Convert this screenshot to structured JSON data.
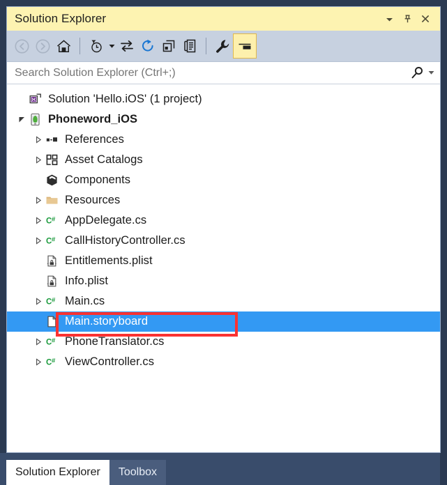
{
  "window": {
    "title": "Solution Explorer",
    "controls": [
      {
        "name": "dropdown-icon",
        "label": "▼"
      },
      {
        "name": "pin-icon",
        "label": "pin"
      },
      {
        "name": "close-icon",
        "label": "✕"
      }
    ]
  },
  "toolbar": {
    "buttons": [
      {
        "name": "back-button",
        "icon": "back-icon",
        "state": "disabled",
        "tooltip": "Back"
      },
      {
        "name": "forward-button",
        "icon": "forward-icon",
        "state": "disabled",
        "tooltip": "Forward"
      },
      {
        "name": "home-button",
        "icon": "home-icon",
        "state": "enabled",
        "tooltip": "Home"
      },
      {
        "name": "pending-changes-button",
        "icon": "clock-filter-icon",
        "state": "enabled",
        "tooltip": "Pending Changes Filter"
      },
      {
        "name": "sync-button",
        "icon": "sync-arrows-icon",
        "state": "enabled",
        "tooltip": "Sync with Active Document"
      },
      {
        "name": "refresh-button",
        "icon": "refresh-icon",
        "state": "enabled",
        "tooltip": "Refresh"
      },
      {
        "name": "collapse-all-button",
        "icon": "collapse-all-icon",
        "state": "enabled",
        "tooltip": "Collapse All"
      },
      {
        "name": "show-all-files-button",
        "icon": "show-all-files-icon",
        "state": "enabled",
        "tooltip": "Show All Files"
      },
      {
        "name": "properties-button",
        "icon": "wrench-icon",
        "state": "enabled",
        "tooltip": "Properties"
      },
      {
        "name": "preview-button",
        "icon": "preview-pane-icon",
        "state": "active",
        "tooltip": "Preview Selected Items"
      }
    ]
  },
  "search": {
    "placeholder": "Search Solution Explorer (Ctrl+;)",
    "value": ""
  },
  "tree": {
    "items": [
      {
        "label": "Solution 'Hello.iOS' (1 project)",
        "icon": "solution-icon",
        "indent": 0,
        "expander": "none",
        "bold": false,
        "selected": false
      },
      {
        "label": "Phoneword_iOS",
        "icon": "ios-project-icon",
        "indent": 0,
        "expander": "expanded",
        "bold": true,
        "selected": false
      },
      {
        "label": "References",
        "icon": "references-icon",
        "indent": 1,
        "expander": "collapsed",
        "bold": false,
        "selected": false
      },
      {
        "label": "Asset Catalogs",
        "icon": "asset-catalog-icon",
        "indent": 1,
        "expander": "collapsed",
        "bold": false,
        "selected": false
      },
      {
        "label": "Components",
        "icon": "components-icon",
        "indent": 1,
        "expander": "none",
        "bold": false,
        "selected": false
      },
      {
        "label": "Resources",
        "icon": "folder-icon",
        "indent": 1,
        "expander": "collapsed",
        "bold": false,
        "selected": false
      },
      {
        "label": "AppDelegate.cs",
        "icon": "csharp-file-icon",
        "indent": 1,
        "expander": "collapsed",
        "bold": false,
        "selected": false
      },
      {
        "label": "CallHistoryController.cs",
        "icon": "csharp-file-icon",
        "indent": 1,
        "expander": "collapsed",
        "bold": false,
        "selected": false
      },
      {
        "label": "Entitlements.plist",
        "icon": "plist-file-icon",
        "indent": 1,
        "expander": "none",
        "bold": false,
        "selected": false
      },
      {
        "label": "Info.plist",
        "icon": "plist-file-icon",
        "indent": 1,
        "expander": "none",
        "bold": false,
        "selected": false
      },
      {
        "label": "Main.cs",
        "icon": "csharp-file-icon",
        "indent": 1,
        "expander": "collapsed",
        "bold": false,
        "selected": false
      },
      {
        "label": "Main.storyboard",
        "icon": "document-icon",
        "indent": 1,
        "expander": "none",
        "bold": false,
        "selected": true
      },
      {
        "label": "PhoneTranslator.cs",
        "icon": "csharp-file-icon",
        "indent": 1,
        "expander": "collapsed",
        "bold": false,
        "selected": false
      },
      {
        "label": "ViewController.cs",
        "icon": "csharp-file-icon",
        "indent": 1,
        "expander": "collapsed",
        "bold": false,
        "selected": false
      }
    ]
  },
  "annotation": {
    "name": "highlight-box",
    "target": "CallHistoryController.cs",
    "color": "#fa3232"
  },
  "tabs": [
    {
      "label": "Solution Explorer",
      "active": true
    },
    {
      "label": "Toolbox",
      "active": false
    }
  ],
  "colors": {
    "titlebar_bg": "#fdf3b1",
    "toolbar_bg": "#c7d1e0",
    "selection_bg": "#3399f3",
    "annotation": "#fa3232",
    "frame_bg": "#2b3a52",
    "tabstrip_bg": "#394c6b",
    "csharp_green": "#1a9a3c"
  }
}
